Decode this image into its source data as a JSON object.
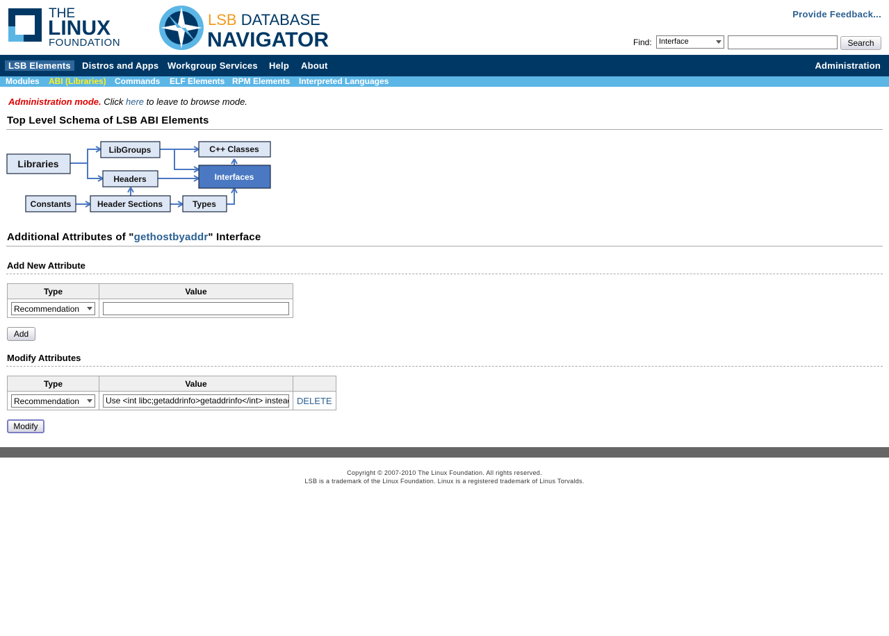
{
  "header": {
    "logo_the": "THE",
    "logo_linux": "LINUX",
    "logo_foundation": "FOUNDATION",
    "lsb_db": "LSB DATABASE",
    "lsb_nav": "NAVIGATOR",
    "feedback": "Provide Feedback...",
    "find_label": "Find:",
    "find_select": "Interface",
    "search_button": "Search"
  },
  "nav": {
    "items": [
      "LSB Elements",
      "Distros and Apps",
      "Workgroup Services",
      "Help",
      "About"
    ],
    "admin": "Administration"
  },
  "subnav": [
    "Modules",
    "ABI (Libraries)",
    "Commands",
    "ELF Elements",
    "RPM Elements",
    "Interpreted Languages"
  ],
  "admin_note": {
    "mode": "Administration mode.",
    "click": " Click ",
    "link": "here",
    "rest": " to leave to browse mode."
  },
  "schema": {
    "title": "Top Level Schema of LSB ABI Elements",
    "nodes": [
      "Libraries",
      "LibGroups",
      "Headers",
      "C++ Classes",
      "Interfaces",
      "Constants",
      "Header Sections",
      "Types"
    ]
  },
  "attributes": {
    "title_prefix": "Additional Attributes of \"",
    "interface": "gethostbyaddr",
    "title_suffix": "\" Interface",
    "add_title": "Add New Attribute",
    "col_type": "Type",
    "col_value": "Value",
    "add_type": "Recommendation",
    "add_value": "",
    "add_button": "Add",
    "modify_title": "Modify Attributes",
    "modify_type": "Recommendation",
    "modify_value": "Use <int libc;getaddrinfo>getaddrinfo</int> instead",
    "delete_link": "DELETE",
    "modify_button": "Modify"
  },
  "footer": {
    "line1": "Copyright © 2007-2010 The Linux Foundation. All rights reserved.",
    "line2": "LSB is a trademark of the Linux Foundation. Linux is a registered trademark of Linus Torvalds."
  },
  "colors": {
    "nav_bg": "#003865",
    "subnav_bg": "#5bb6e6",
    "active_sub": "#fff21c",
    "link": "#2b6091",
    "admin_red": "#e00000"
  }
}
